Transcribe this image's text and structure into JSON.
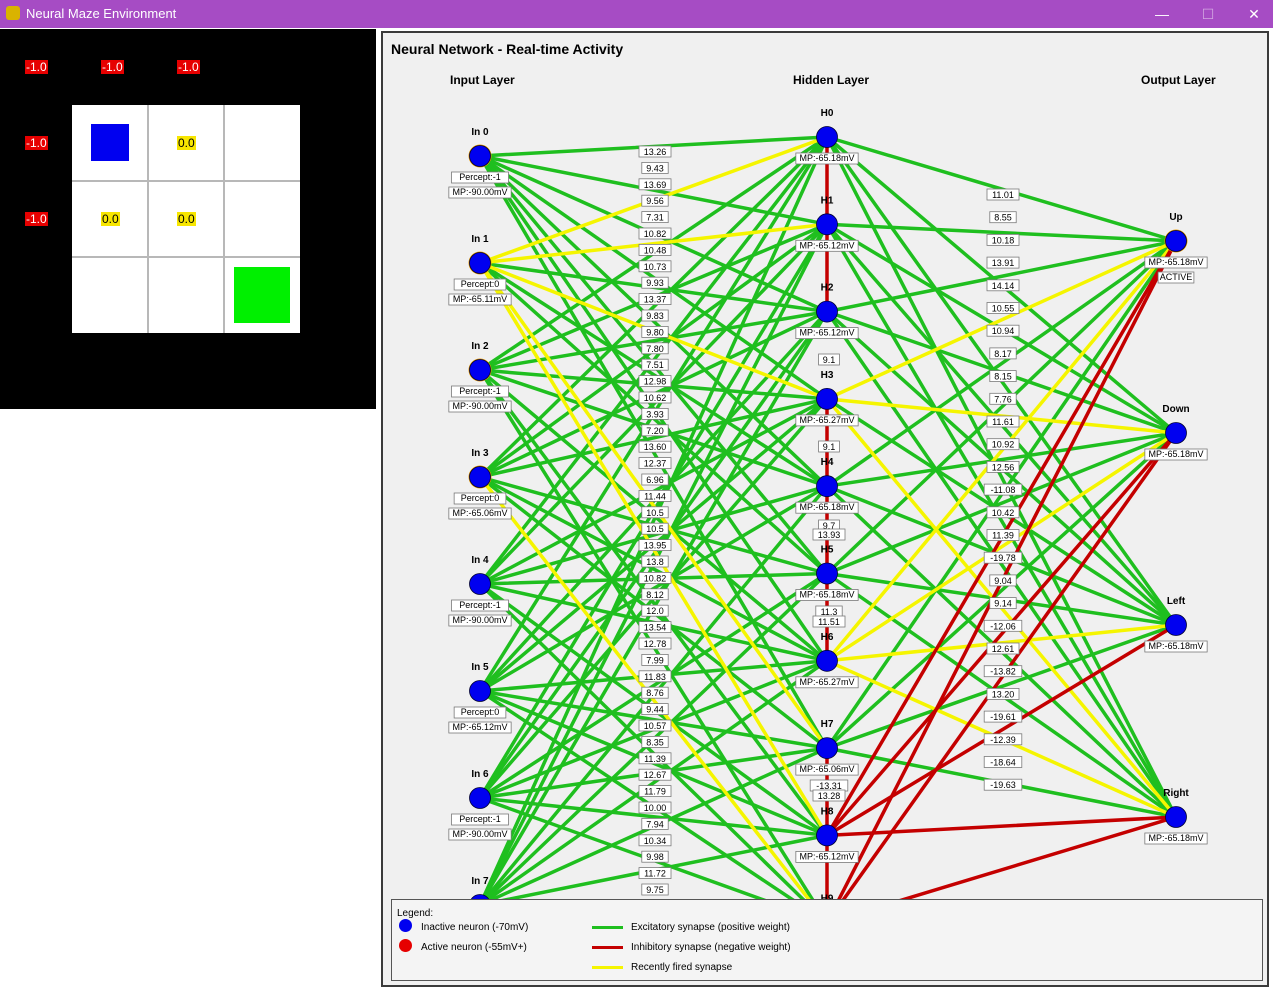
{
  "window": {
    "title": "Neural Maze Environment"
  },
  "maze": {
    "rewards": [
      "-1.0",
      "-1.0",
      "-1.0",
      "-1.0",
      "0.0",
      "-1.0",
      "0.0",
      "0.0"
    ]
  },
  "network": {
    "title": "Neural Network - Real-time Activity",
    "layers": {
      "input": "Input Layer",
      "hidden": "Hidden Layer",
      "output": "Output Layer"
    },
    "input_neurons": [
      {
        "name": "In 0",
        "percept": "Percept:-1",
        "mp": "MP:-90.00mV",
        "recent": true
      },
      {
        "name": "In 1",
        "percept": "Percept:0",
        "mp": "MP:-65.11mV",
        "recent": true
      },
      {
        "name": "In 2",
        "percept": "Percept:-1",
        "mp": "MP:-90.00mV",
        "recent": true
      },
      {
        "name": "In 3",
        "percept": "Percept:0",
        "mp": "MP:-65.06mV",
        "recent": true
      },
      {
        "name": "In 4",
        "percept": "Percept:-1",
        "mp": "MP:-90.00mV",
        "recent": false
      },
      {
        "name": "In 5",
        "percept": "Percept:0",
        "mp": "MP:-65.12mV",
        "recent": false
      },
      {
        "name": "In 6",
        "percept": "Percept:-1",
        "mp": "MP:-90.00mV",
        "recent": false
      },
      {
        "name": "In 7",
        "percept": "",
        "mp": "",
        "recent": false
      }
    ],
    "hidden_neurons": [
      {
        "name": "H0",
        "mp": "MP:-65.18mV"
      },
      {
        "name": "H1",
        "mp": "MP:-65.12mV"
      },
      {
        "name": "H2",
        "mp": "MP:-65.12mV"
      },
      {
        "name": "H3",
        "mp": "MP:-65.27mV"
      },
      {
        "name": "H4",
        "mp": "MP:-65.18mV"
      },
      {
        "name": "H5",
        "mp": "MP:-65.18mV"
      },
      {
        "name": "H6",
        "mp": "MP:-65.27mV"
      },
      {
        "name": "H7",
        "mp": "MP:-65.06mV"
      },
      {
        "name": "H8",
        "mp": "MP:-65.12mV"
      },
      {
        "name": "H9",
        "mp": ""
      }
    ],
    "output_neurons": [
      {
        "name": "Up",
        "mp": "MP:-65.18mV",
        "status": "ACTIVE",
        "recent": true
      },
      {
        "name": "Down",
        "mp": "MP:-65.18mV",
        "status": "",
        "recent": false
      },
      {
        "name": "Left",
        "mp": "MP:-65.18mV",
        "status": "",
        "recent": false
      },
      {
        "name": "Right",
        "mp": "MP:-65.18mV",
        "status": "",
        "recent": false
      }
    ],
    "input_weight_labels": [
      "13.26",
      "9.43",
      "13.69",
      "9.56",
      "7.31",
      "10.82",
      "10.48",
      "10.73",
      "9.93",
      "13.37",
      "9.83",
      "9.80",
      "7.80",
      "7.51",
      "12.98",
      "10.62",
      "3.93",
      "7.20",
      "13.60",
      "12.37",
      "6.96",
      "11.44",
      "10.5",
      "10.5",
      "13.95",
      "13.8",
      "10.82",
      "8.12",
      "12.0",
      "13.54",
      "12.78",
      "7.99",
      "11.83",
      "8.76",
      "9.44",
      "10.57",
      "8.35",
      "11.39",
      "12.67",
      "11.79",
      "10.00",
      "7.94",
      "10.34",
      "9.98",
      "11.72",
      "9.75"
    ],
    "output_weight_labels": [
      "11.01",
      "8.55",
      "10.18",
      "13.91",
      "14.14",
      "10.55",
      "10.94",
      "8.17",
      "8.15",
      "7.76",
      "11.61",
      "10.92",
      "12.56",
      "-11.08",
      "10.42",
      "11.39",
      "-19.78",
      "9.04",
      "9.14",
      "-12.06",
      "12.61",
      "-13.82",
      "13.20",
      "-19.61",
      "-12.39",
      "-18.64",
      "-19.63"
    ],
    "hidden_weight_labels": [
      "9.1",
      "9.1",
      "9.7",
      "13.93",
      "11.3",
      "11.51",
      "-13.31",
      "13.28"
    ],
    "synapses": [
      {
        "from": "I0",
        "to": "H0",
        "type": "exc",
        "label": "13.26"
      },
      {
        "from": "I0",
        "to": "H1",
        "type": "exc",
        "label": "9.43"
      },
      {
        "from": "I0",
        "to": "H2",
        "type": "exc"
      },
      {
        "from": "I0",
        "to": "H3",
        "type": "exc"
      },
      {
        "from": "I0",
        "to": "H4",
        "type": "exc"
      },
      {
        "from": "I0",
        "to": "H5",
        "type": "exc"
      },
      {
        "from": "I0",
        "to": "H6",
        "type": "exc"
      },
      {
        "from": "I0",
        "to": "H7",
        "type": "exc"
      },
      {
        "from": "I1",
        "to": "H0",
        "type": "fired",
        "label": "13.69"
      },
      {
        "from": "I1",
        "to": "H1",
        "type": "fired",
        "label": "7.31"
      },
      {
        "from": "I1",
        "to": "H2",
        "type": "exc",
        "label": "9.56"
      },
      {
        "from": "I1",
        "to": "H3",
        "type": "fired"
      },
      {
        "from": "I1",
        "to": "H4",
        "type": "exc"
      },
      {
        "from": "I1",
        "to": "H5",
        "type": "exc"
      },
      {
        "from": "I1",
        "to": "H7",
        "type": "fired"
      },
      {
        "from": "I1",
        "to": "H8",
        "type": "fired"
      },
      {
        "from": "I2",
        "to": "H0",
        "type": "exc"
      },
      {
        "from": "I2",
        "to": "H1",
        "type": "exc"
      },
      {
        "from": "I2",
        "to": "H2",
        "type": "exc"
      },
      {
        "from": "I2",
        "to": "H3",
        "type": "exc"
      },
      {
        "from": "I2",
        "to": "H4",
        "type": "exc"
      },
      {
        "from": "I2",
        "to": "H6",
        "type": "exc"
      },
      {
        "from": "I2",
        "to": "H8",
        "type": "exc"
      },
      {
        "from": "I2",
        "to": "H9",
        "type": "exc"
      },
      {
        "from": "I3",
        "to": "H0",
        "type": "exc"
      },
      {
        "from": "I3",
        "to": "H1",
        "type": "exc"
      },
      {
        "from": "I3",
        "to": "H2",
        "type": "exc"
      },
      {
        "from": "I3",
        "to": "H3",
        "type": "exc"
      },
      {
        "from": "I3",
        "to": "H5",
        "type": "exc"
      },
      {
        "from": "I3",
        "to": "H6",
        "type": "exc"
      },
      {
        "from": "I3",
        "to": "H7",
        "type": "exc"
      },
      {
        "from": "I3",
        "to": "H9",
        "type": "fired"
      },
      {
        "from": "I4",
        "to": "H0",
        "type": "exc"
      },
      {
        "from": "I4",
        "to": "H1",
        "type": "exc"
      },
      {
        "from": "I4",
        "to": "H3",
        "type": "exc"
      },
      {
        "from": "I4",
        "to": "H4",
        "type": "exc"
      },
      {
        "from": "I4",
        "to": "H5",
        "type": "exc"
      },
      {
        "from": "I4",
        "to": "H6",
        "type": "exc"
      },
      {
        "from": "I4",
        "to": "H8",
        "type": "exc"
      },
      {
        "from": "I4",
        "to": "H9",
        "type": "exc"
      },
      {
        "from": "I5",
        "to": "H0",
        "type": "exc"
      },
      {
        "from": "I5",
        "to": "H2",
        "type": "exc"
      },
      {
        "from": "I5",
        "to": "H3",
        "type": "exc"
      },
      {
        "from": "I5",
        "to": "H4",
        "type": "exc"
      },
      {
        "from": "I5",
        "to": "H6",
        "type": "exc"
      },
      {
        "from": "I5",
        "to": "H7",
        "type": "exc"
      },
      {
        "from": "I5",
        "to": "H8",
        "type": "exc"
      },
      {
        "from": "I5",
        "to": "H9",
        "type": "exc"
      },
      {
        "from": "I6",
        "to": "H1",
        "type": "exc"
      },
      {
        "from": "I6",
        "to": "H2",
        "type": "exc"
      },
      {
        "from": "I6",
        "to": "H3",
        "type": "exc"
      },
      {
        "from": "I6",
        "to": "H5",
        "type": "exc"
      },
      {
        "from": "I6",
        "to": "H6",
        "type": "exc"
      },
      {
        "from": "I6",
        "to": "H7",
        "type": "exc"
      },
      {
        "from": "I6",
        "to": "H8",
        "type": "exc"
      },
      {
        "from": "I6",
        "to": "H9",
        "type": "exc"
      },
      {
        "from": "I7",
        "to": "H0",
        "type": "exc"
      },
      {
        "from": "I7",
        "to": "H1",
        "type": "exc"
      },
      {
        "from": "I7",
        "to": "H2",
        "type": "exc"
      },
      {
        "from": "I7",
        "to": "H4",
        "type": "exc"
      },
      {
        "from": "I7",
        "to": "H5",
        "type": "exc"
      },
      {
        "from": "I7",
        "to": "H6",
        "type": "exc"
      },
      {
        "from": "I7",
        "to": "H7",
        "type": "exc"
      },
      {
        "from": "I7",
        "to": "H8",
        "type": "exc"
      },
      {
        "from": "H0",
        "to": "O0",
        "type": "exc",
        "label": "11.01"
      },
      {
        "from": "H0",
        "to": "O1",
        "type": "exc"
      },
      {
        "from": "H0",
        "to": "O2",
        "type": "exc"
      },
      {
        "from": "H0",
        "to": "O3",
        "type": "exc"
      },
      {
        "from": "H1",
        "to": "O0",
        "type": "exc",
        "label": "8.55"
      },
      {
        "from": "H1",
        "to": "O1",
        "type": "exc",
        "label": "10.18"
      },
      {
        "from": "H1",
        "to": "O2",
        "type": "exc"
      },
      {
        "from": "H1",
        "to": "O3",
        "type": "exc"
      },
      {
        "from": "H2",
        "to": "O0",
        "type": "exc",
        "label": "13.91"
      },
      {
        "from": "H2",
        "to": "O1",
        "type": "exc",
        "label": "10.55"
      },
      {
        "from": "H2",
        "to": "O2",
        "type": "exc"
      },
      {
        "from": "H2",
        "to": "O3",
        "type": "exc"
      },
      {
        "from": "H3",
        "to": "O0",
        "type": "fired",
        "label": "14.14"
      },
      {
        "from": "H3",
        "to": "O1",
        "type": "fired",
        "label": "8.17"
      },
      {
        "from": "H3",
        "to": "O2",
        "type": "exc"
      },
      {
        "from": "H3",
        "to": "O3",
        "type": "fired"
      },
      {
        "from": "H4",
        "to": "O0",
        "type": "exc"
      },
      {
        "from": "H4",
        "to": "O1",
        "type": "exc",
        "label": "7.76"
      },
      {
        "from": "H4",
        "to": "O2",
        "type": "exc",
        "label": "10.92"
      },
      {
        "from": "H4",
        "to": "O3",
        "type": "exc"
      },
      {
        "from": "H5",
        "to": "O0",
        "type": "exc"
      },
      {
        "from": "H5",
        "to": "O1",
        "type": "exc"
      },
      {
        "from": "H5",
        "to": "O2",
        "type": "exc",
        "label": "9.04"
      },
      {
        "from": "H5",
        "to": "O3",
        "type": "exc"
      },
      {
        "from": "H6",
        "to": "O0",
        "type": "fired"
      },
      {
        "from": "H6",
        "to": "O1",
        "type": "fired"
      },
      {
        "from": "H6",
        "to": "O2",
        "type": "fired",
        "label": "12.61"
      },
      {
        "from": "H6",
        "to": "O3",
        "type": "fired",
        "label": "-19.61"
      },
      {
        "from": "H7",
        "to": "O0",
        "type": "exc"
      },
      {
        "from": "H7",
        "to": "O1",
        "type": "exc"
      },
      {
        "from": "H7",
        "to": "O2",
        "type": "exc"
      },
      {
        "from": "H7",
        "to": "O3",
        "type": "exc",
        "label": "-12.39"
      },
      {
        "from": "H8",
        "to": "O0",
        "type": "inh",
        "label": "-11.08"
      },
      {
        "from": "H8",
        "to": "O1",
        "type": "inh",
        "label": "-19.78"
      },
      {
        "from": "H8",
        "to": "O2",
        "type": "inh",
        "label": "-12.06"
      },
      {
        "from": "H8",
        "to": "O3",
        "type": "inh",
        "label": "-18.64"
      },
      {
        "from": "H9",
        "to": "O0",
        "type": "inh",
        "label": "-13.82"
      },
      {
        "from": "H9",
        "to": "O1",
        "type": "inh"
      },
      {
        "from": "H9",
        "to": "O3",
        "type": "inh",
        "label": "-19.63"
      },
      {
        "from": "H1",
        "to": "H2",
        "type": "inh",
        "label": "9.1"
      },
      {
        "from": "H3",
        "to": "H4",
        "type": "inh",
        "label": "9.1"
      },
      {
        "from": "H4",
        "to": "H5",
        "type": "inh",
        "label": "9.7"
      },
      {
        "from": "H5",
        "to": "H6",
        "type": "inh",
        "label": "11.3"
      },
      {
        "from": "H7",
        "to": "H8",
        "type": "inh",
        "label": "-13.31"
      },
      {
        "from": "H0",
        "to": "H1",
        "type": "inh"
      },
      {
        "from": "H8",
        "to": "H9",
        "type": "inh"
      }
    ]
  },
  "legend": {
    "title": "Legend:",
    "inactive": "Inactive neuron (-70mV)",
    "active": "Active neuron (-55mV+)",
    "excitatory": "Excitatory synapse (positive weight)",
    "inhibitory": "Inhibitory synapse (negative weight)",
    "fired": "Recently fired synapse"
  },
  "colors": {
    "titlebar": "#a64cc4",
    "neuron_inactive": "#0000f0",
    "neuron_active": "#e60000",
    "recent_ring": "#f0a000",
    "excitatory": "#1fbf1f",
    "inhibitory": "#c40000",
    "fired": "#f5f500",
    "agent": "#0000f0",
    "goal": "#00f000"
  }
}
